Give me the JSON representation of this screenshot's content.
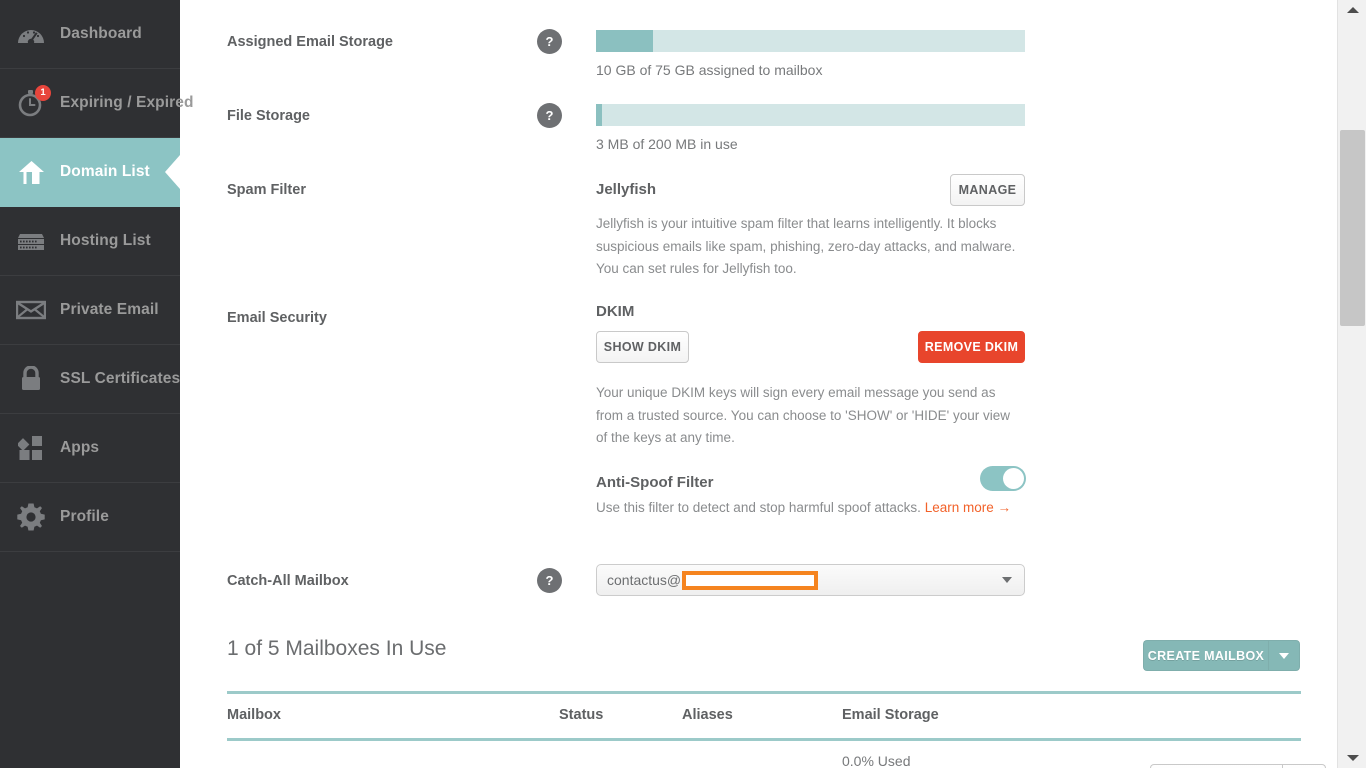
{
  "sidebar": {
    "items": [
      {
        "label": "Dashboard",
        "icon": "dashboard-gauge-icon",
        "active": false,
        "badge": null
      },
      {
        "label": "Expiring / Expired",
        "icon": "stopwatch-icon",
        "active": false,
        "badge": "1"
      },
      {
        "label": "Domain List",
        "icon": "home-icon",
        "active": true,
        "badge": null
      },
      {
        "label": "Hosting List",
        "icon": "server-icon",
        "active": false,
        "badge": null
      },
      {
        "label": "Private Email",
        "icon": "envelope-icon",
        "active": false,
        "badge": null
      },
      {
        "label": "SSL Certificates",
        "icon": "lock-icon",
        "active": false,
        "badge": null
      },
      {
        "label": "Apps",
        "icon": "apps-icon",
        "active": false,
        "badge": null
      },
      {
        "label": "Profile",
        "icon": "gear-icon",
        "active": false,
        "badge": null
      }
    ]
  },
  "assigned_email_storage": {
    "label": "Assigned Email Storage",
    "help": "?",
    "caption": "10 GB of 75 GB assigned to mailbox",
    "percent": 13.3,
    "used": "10 GB",
    "total": "75 GB"
  },
  "file_storage": {
    "label": "File Storage",
    "help": "?",
    "caption": "3 MB of 200 MB in use",
    "percent": 1.5,
    "used": "3 MB",
    "total": "200 MB"
  },
  "spam_filter": {
    "label": "Spam Filter",
    "name": "Jellyfish",
    "manage_button": "MANAGE",
    "description": "Jellyfish is your intuitive spam filter that learns intelligently. It blocks suspicious emails like spam, phishing, zero-day attacks, and malware. You can set rules for Jellyfish too."
  },
  "email_security": {
    "label": "Email Security",
    "dkim_title": "DKIM",
    "show_dkim_button": "SHOW DKIM",
    "remove_dkim_button": "REMOVE DKIM",
    "dkim_description": "Your unique DKIM keys will sign every email message you send as from a trusted source. You can choose to 'SHOW' or 'HIDE' your view of the keys at any time.",
    "anti_spoof_title": "Anti-Spoof Filter",
    "anti_spoof_description": "Use this filter to detect and stop harmful spoof attacks.",
    "anti_spoof_link": "Learn more →",
    "anti_spoof_enabled": true
  },
  "catch_all": {
    "label": "Catch-All Mailbox",
    "help": "?",
    "value_prefix": "contactus@",
    "value_redacted": true
  },
  "mailboxes": {
    "heading": "1 of 5 Mailboxes In Use",
    "create_button": "CREATE MAILBOX",
    "columns": [
      "Mailbox",
      "Status",
      "Aliases",
      "Email Storage"
    ],
    "rows": [
      {
        "mailbox": "",
        "status": "",
        "aliases": "",
        "email_storage": "0.0% Used"
      }
    ]
  },
  "colors": {
    "sidebar_bg": "#2f3033",
    "accent_teal": "#8cc4c4",
    "bar_fill": "#8bc0c0",
    "bar_track": "#d3e6e6",
    "danger_red": "#e8452c",
    "link_orange": "#f2622a",
    "redaction_orange": "#f5841f",
    "badge_red": "#e8453c",
    "primary_button": "#85b8b6",
    "table_rule": "#9ccac9"
  }
}
